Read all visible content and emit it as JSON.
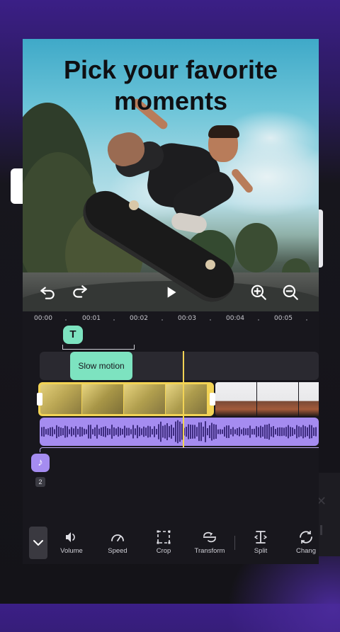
{
  "headline": {
    "line1": "Pick your favorite",
    "line2": "moments"
  },
  "timecodes": [
    "00:00",
    "00:01",
    "00:02",
    "00:03",
    "00:04",
    "00:05"
  ],
  "text_track": {
    "marker": "T"
  },
  "effect_track": {
    "clip_label": "Slow motion"
  },
  "audio_track": {
    "count": "2"
  },
  "toolbar": {
    "tools": [
      {
        "label": "Volume",
        "icon": "volume-icon"
      },
      {
        "label": "Speed",
        "icon": "speed-icon"
      },
      {
        "label": "Crop",
        "icon": "crop-icon"
      },
      {
        "label": "Transform",
        "icon": "transform-icon"
      },
      {
        "label": "Split",
        "icon": "split-icon"
      },
      {
        "label": "Chang",
        "icon": "change-icon"
      }
    ]
  },
  "colors": {
    "accent_teal": "#7de3c0",
    "accent_yellow": "#f2d355",
    "accent_purple": "#a58cf0",
    "background": "#18171d"
  }
}
